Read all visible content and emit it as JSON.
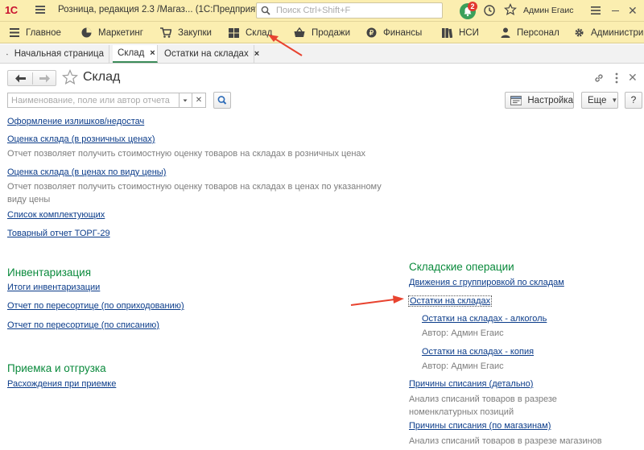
{
  "titlebar": {
    "logo": "1С",
    "title": "Розница, редакция 2.3 /Магаз...  (1С:Предприятие)",
    "search_placeholder": "Поиск Ctrl+Shift+F",
    "notifications_count": "2",
    "user": "Админ Егаис"
  },
  "sections": [
    {
      "label": "Главное",
      "icon": "hamburger-icon"
    },
    {
      "label": "Маркетинг",
      "icon": "marketing-icon"
    },
    {
      "label": "Закупки",
      "icon": "cart-icon"
    },
    {
      "label": "Склад",
      "icon": "warehouse-icon"
    },
    {
      "label": "Продажи",
      "icon": "basket-icon"
    },
    {
      "label": "Финансы",
      "icon": "finance-icon"
    },
    {
      "label": "НСИ",
      "icon": "books-icon"
    },
    {
      "label": "Персонал",
      "icon": "person-icon"
    },
    {
      "label": "Администри",
      "icon": "gear-icon"
    }
  ],
  "tabs": [
    {
      "label": "Начальная страница",
      "icon": "home-icon"
    },
    {
      "label": "Склад",
      "close": "×"
    },
    {
      "label": "Остатки на складах",
      "close": "×"
    }
  ],
  "page": {
    "title": "Склад",
    "filter_placeholder": "Наименование, поле или автор отчета",
    "settings_label": "Настройка",
    "more_label": "Еще",
    "help_label": "?"
  },
  "left_reports": [
    {
      "label": "Оформление излишков/недостач"
    },
    {
      "label": "Оценка склада (в розничных ценах)",
      "desc": "Отчет позволяет получить стоимостную оценку товаров на складах в розничных ценах"
    },
    {
      "label": "Оценка склада (в ценах по виду цены)",
      "desc": "Отчет позволяет получить стоимостную оценку товаров на складах в ценах по указанному виду цены"
    },
    {
      "label": "Список комплектующих"
    },
    {
      "label": "Товарный отчет ТОРГ-29"
    }
  ],
  "inventory": {
    "title": "Инвентаризация",
    "items": [
      "Итоги инвентаризации",
      "Отчет по пересортице (по оприходованию)",
      "Отчет по пересортице (по списанию)"
    ]
  },
  "receipt": {
    "title": "Приемка и отгрузка",
    "items": [
      "Расхождения при приемке"
    ]
  },
  "warehouse_ops": {
    "title": "Складские операции",
    "items": [
      {
        "label": "Движения с группировкой по складам"
      },
      {
        "label": "Остатки на складах"
      },
      {
        "label": "Остатки на складах - алкоголь",
        "author": "Автор: Админ Егаис"
      },
      {
        "label": "Остатки на складах - копия",
        "author": "Автор: Админ Егаис"
      },
      {
        "label": "Причины списания (детально)",
        "desc": "Анализ списаний товаров в разрезе номенклатурных позиций"
      },
      {
        "label": "Причины списания (по магазинам)",
        "desc": "Анализ списаний товаров в разрезе магазинов"
      }
    ]
  },
  "colors": {
    "topbar": "#fbeeb0",
    "link": "#0b3c8a",
    "group_title": "#0a8a3c",
    "annotation_arrow": "#e8432f"
  }
}
